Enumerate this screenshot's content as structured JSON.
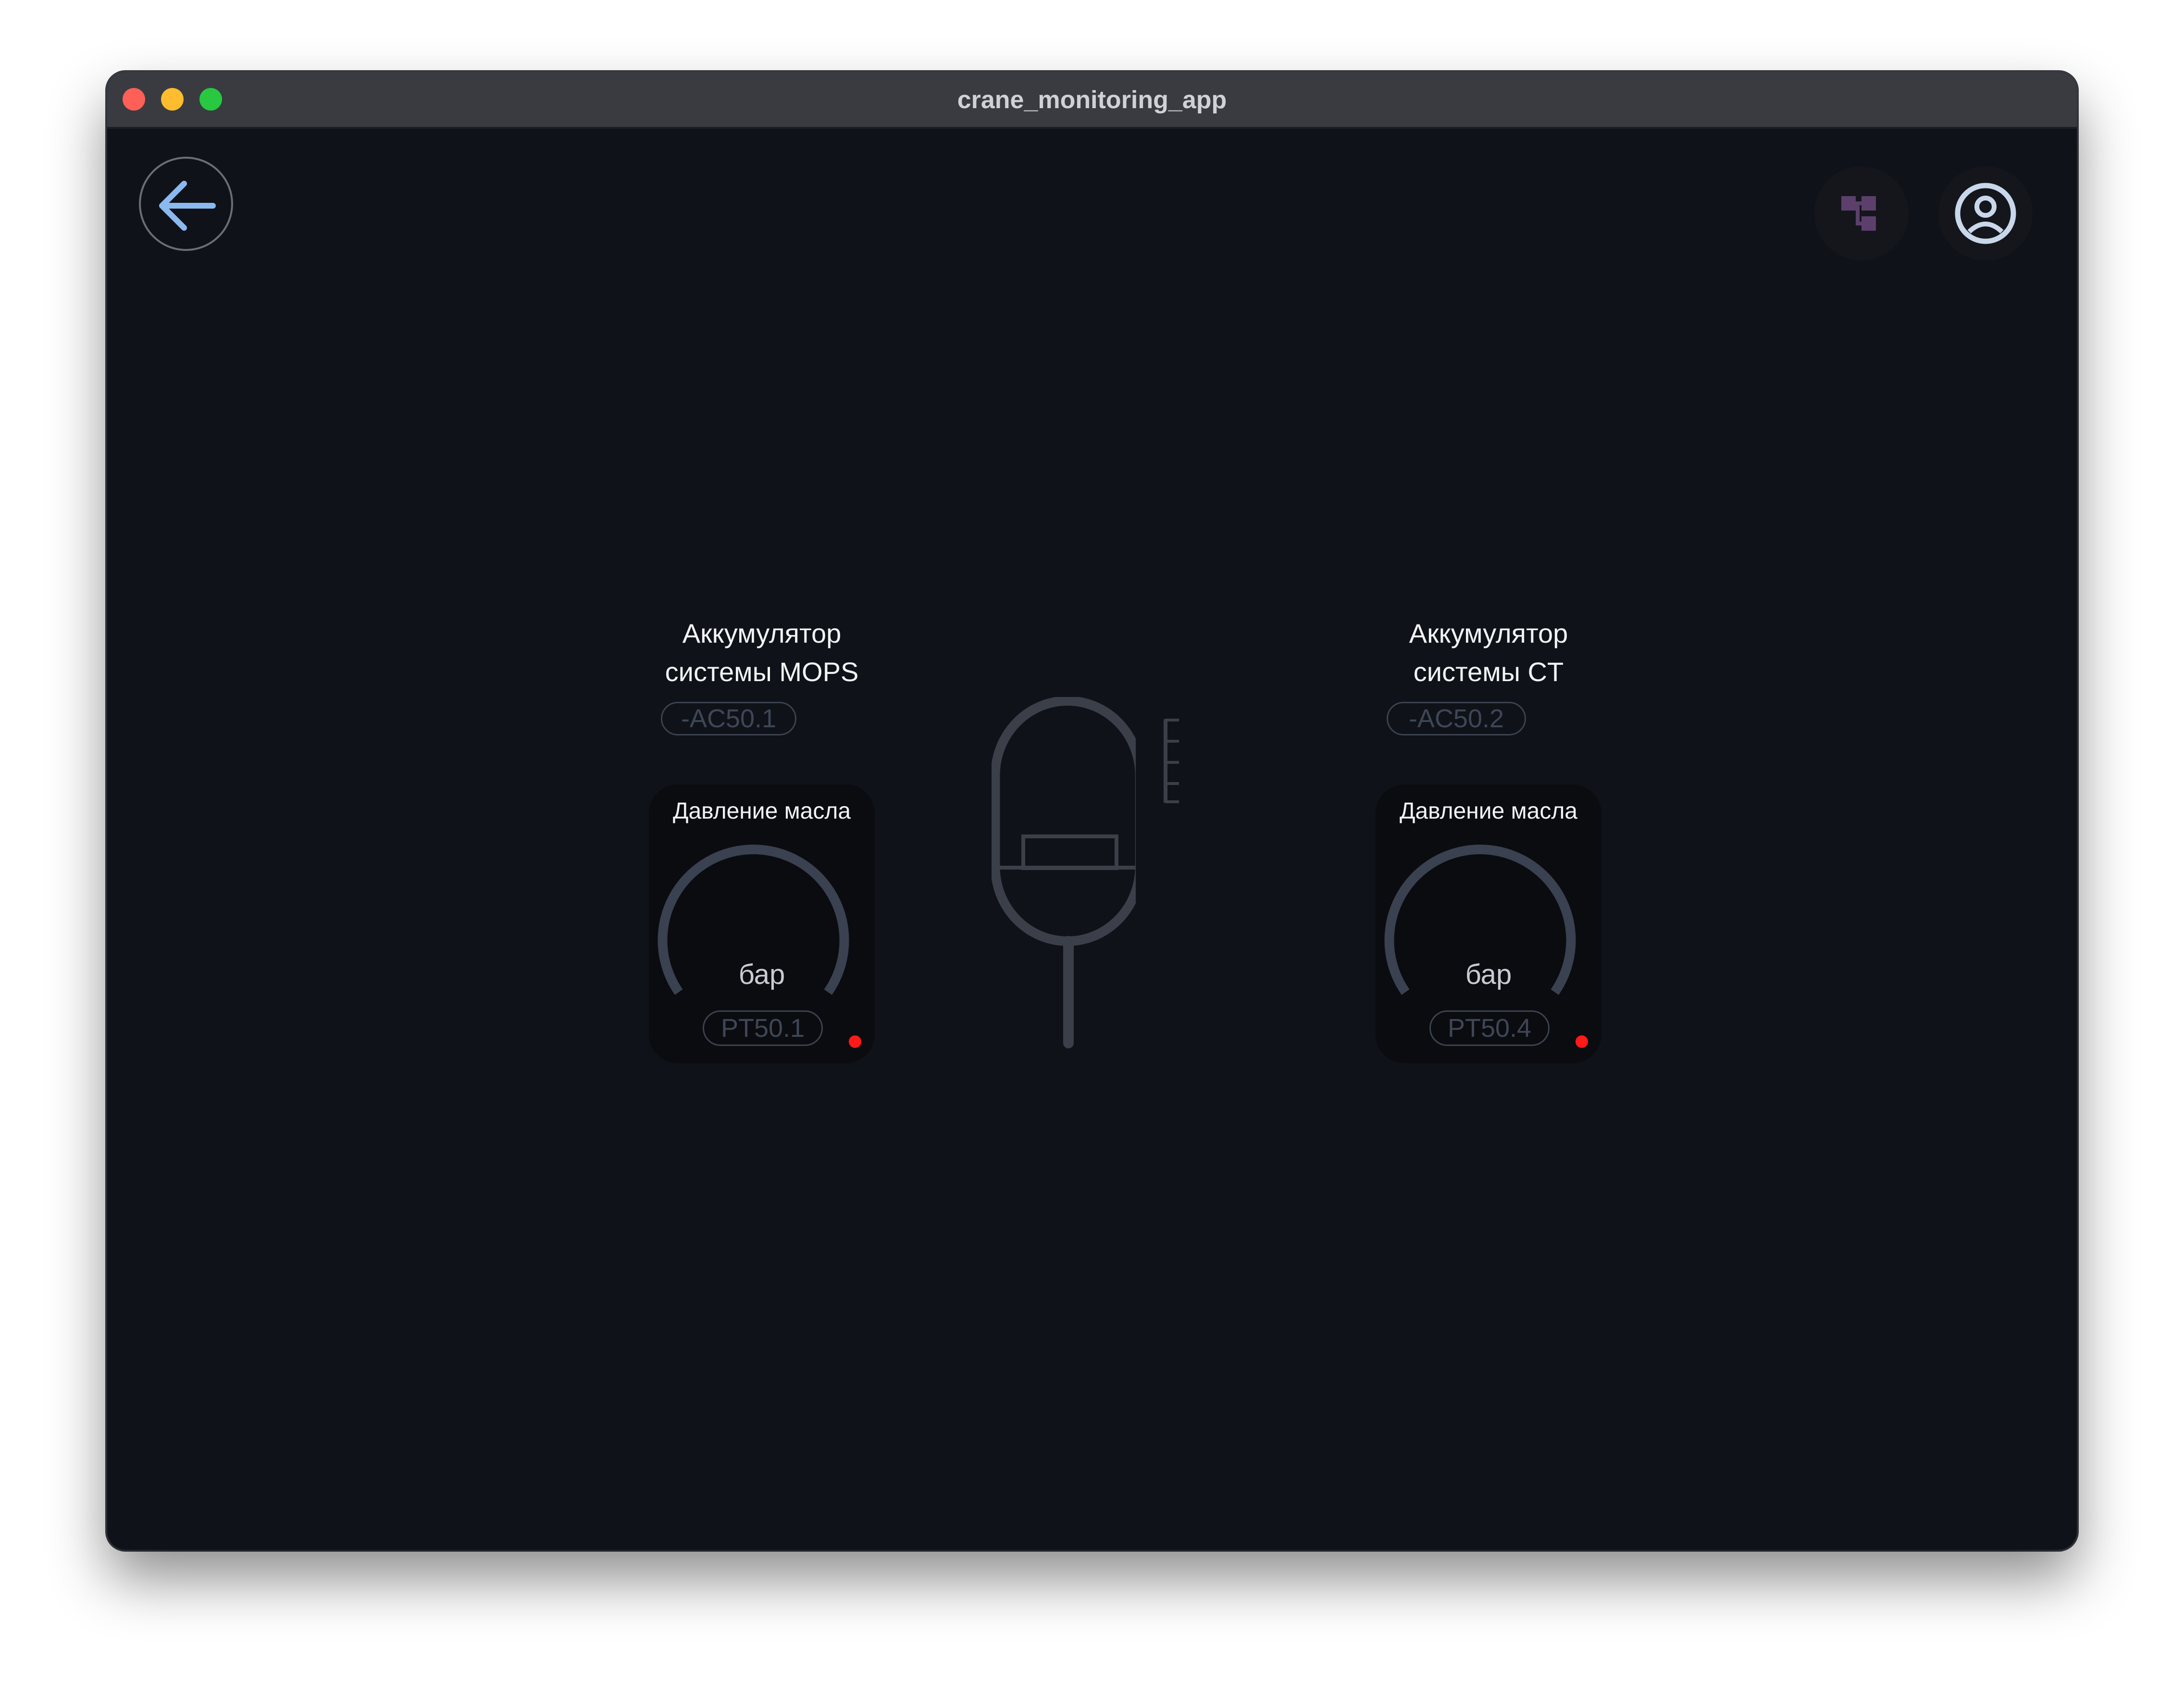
{
  "window": {
    "title": "crane_monitoring_app"
  },
  "toolbar": {
    "back_icon": "arrow-left-icon",
    "tree_icon": "hierarchy-icon",
    "user_icon": "user-circle-icon"
  },
  "accumulators": [
    {
      "title_line1": "Аккумулятор",
      "title_line2": "системы MOPS",
      "tag": "-AC50.1",
      "gauge": {
        "title": "Давление масла",
        "unit": "бар",
        "sensor_tag": "PT50.1",
        "status_color": "#ff1a1a"
      }
    },
    {
      "title_line1": "Аккумулятор",
      "title_line2": "системы CT",
      "tag": "-AC50.2",
      "gauge": {
        "title": "Давление масла",
        "unit": "бар",
        "sensor_tag": "PT50.4",
        "status_color": "#ff1a1a"
      }
    }
  ],
  "colors": {
    "background": "#0f1218",
    "accent_blue": "#8ab9f0",
    "tree_icon": "#5c3f6b",
    "muted_stroke": "#3b4250"
  }
}
